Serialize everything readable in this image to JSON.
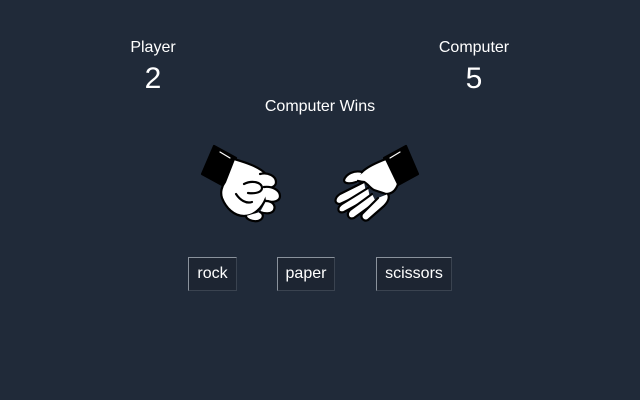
{
  "scoreboard": {
    "player_label": "Player",
    "player_score": "2",
    "computer_label": "Computer",
    "computer_score": "5"
  },
  "result": "Computer Wins",
  "hands": {
    "player_choice_icon": "rock-fist-icon",
    "computer_choice_icon": "paper-open-hand-icon"
  },
  "choices": {
    "rock": "rock",
    "paper": "paper",
    "scissors": "scissors"
  },
  "colors": {
    "background": "#202a39",
    "text": "#ffffff",
    "button_bg": "#1d2532"
  }
}
